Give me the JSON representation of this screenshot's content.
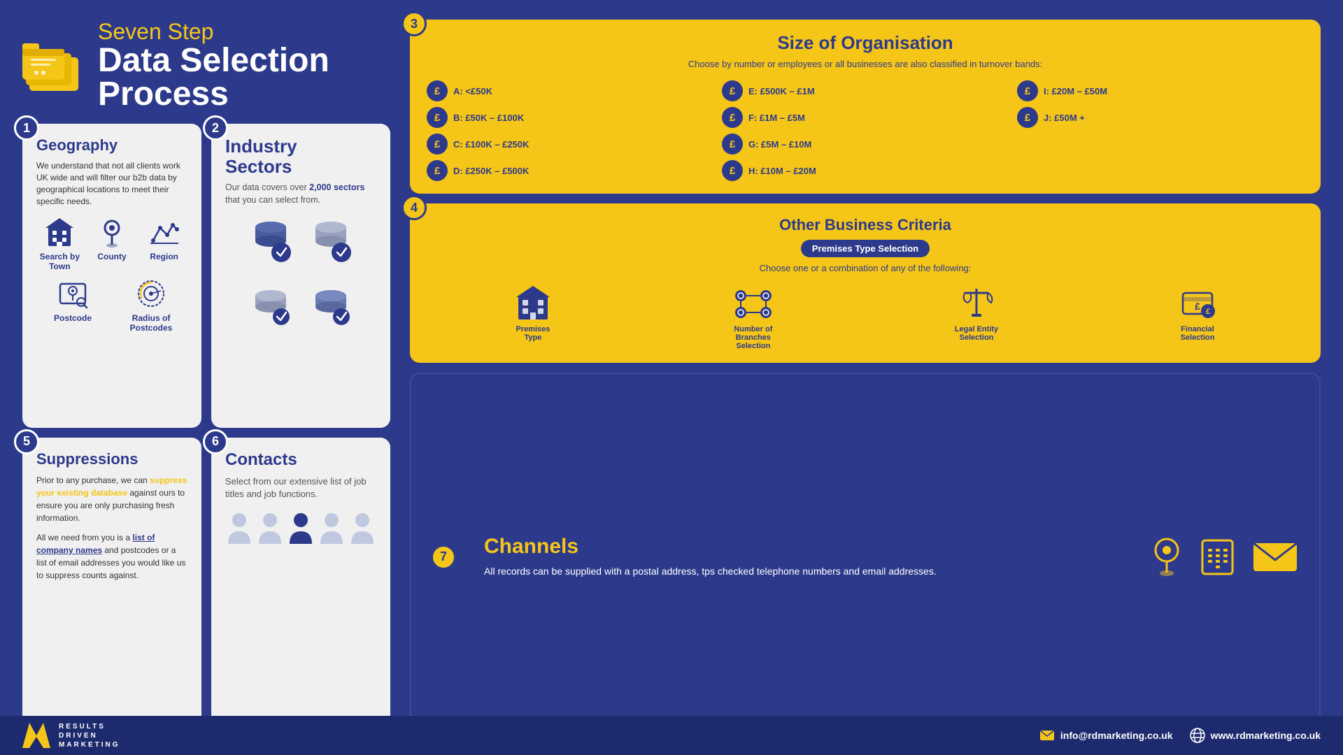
{
  "header": {
    "subtitle": "Seven Step",
    "title": "Data Selection Process"
  },
  "steps": {
    "step1": {
      "number": "1",
      "title": "Geography",
      "description": "We understand that not all clients work UK wide and will filter our b2b data by geographical locations to meet their specific needs.",
      "geo_items": [
        {
          "label": "Search by Town",
          "icon": "building"
        },
        {
          "label": "County",
          "icon": "pin"
        },
        {
          "label": "Region",
          "icon": "region"
        },
        {
          "label": "Postcode",
          "icon": "postcode"
        },
        {
          "label": "Radius of Postcodes",
          "icon": "radius"
        }
      ]
    },
    "step2": {
      "number": "2",
      "title": "Industry\nSectors",
      "description": "Our data covers over ",
      "highlight": "2,000",
      "description2": " sectors that you can select from."
    },
    "step3": {
      "number": "3",
      "title": "Size of Organisation",
      "subtitle": "Choose by number or employees or all businesses are also classified in turnover bands:",
      "bands": [
        {
          "key": "A:",
          "value": "<£50K"
        },
        {
          "key": "E:",
          "value": "£500K – £1M"
        },
        {
          "key": "I:",
          "value": "£20M – £50M"
        },
        {
          "key": "B:",
          "value": "£50K – £100K"
        },
        {
          "key": "F:",
          "value": "£1M – £5M"
        },
        {
          "key": "J:",
          "value": "£50M +"
        },
        {
          "key": "C:",
          "value": "£100K – £250K"
        },
        {
          "key": "G:",
          "value": "£5M – £10M"
        },
        {
          "key": "",
          "value": ""
        },
        {
          "key": "D:",
          "value": "£250K – £500K"
        },
        {
          "key": "H:",
          "value": "£10M – £20M"
        },
        {
          "key": "",
          "value": ""
        }
      ]
    },
    "step4": {
      "number": "4",
      "title": "Other Business Criteria",
      "badge": "Premises Type Selection",
      "subtitle": "Choose one or a combination of any of the following:",
      "items": [
        {
          "label": "Premises\nType"
        },
        {
          "label": "Number of\nBranches\nSelection"
        },
        {
          "label": "Legal Entity\nSelection"
        },
        {
          "label": "Financial\nSelection"
        }
      ]
    },
    "step5": {
      "number": "5",
      "title": "Suppressions",
      "para1_before": "Prior to any purchase, we can ",
      "para1_highlight": "suppress your existing database",
      "para1_after": " against ours to ensure you are only purchasing fresh information.",
      "para2_before": "All we need from you is a ",
      "para2_highlight": "list of company names",
      "para2_after": " and postcodes or a list of email addresses you would like us to suppress counts against."
    },
    "step6": {
      "number": "6",
      "title": "Contacts",
      "description": "Select from our extensive list of job titles and job functions."
    },
    "step7": {
      "number": "7",
      "title": "Channels",
      "description": "All records can be supplied with a postal address, tps checked telephone numbers and email addresses."
    }
  },
  "footer": {
    "logo_line1": "RESULTS",
    "logo_line2": "DRIVEN",
    "logo_line3": "MARKETING",
    "email": "info@rdmarketing.co.uk",
    "website": "www.rdmarketing.co.uk"
  }
}
